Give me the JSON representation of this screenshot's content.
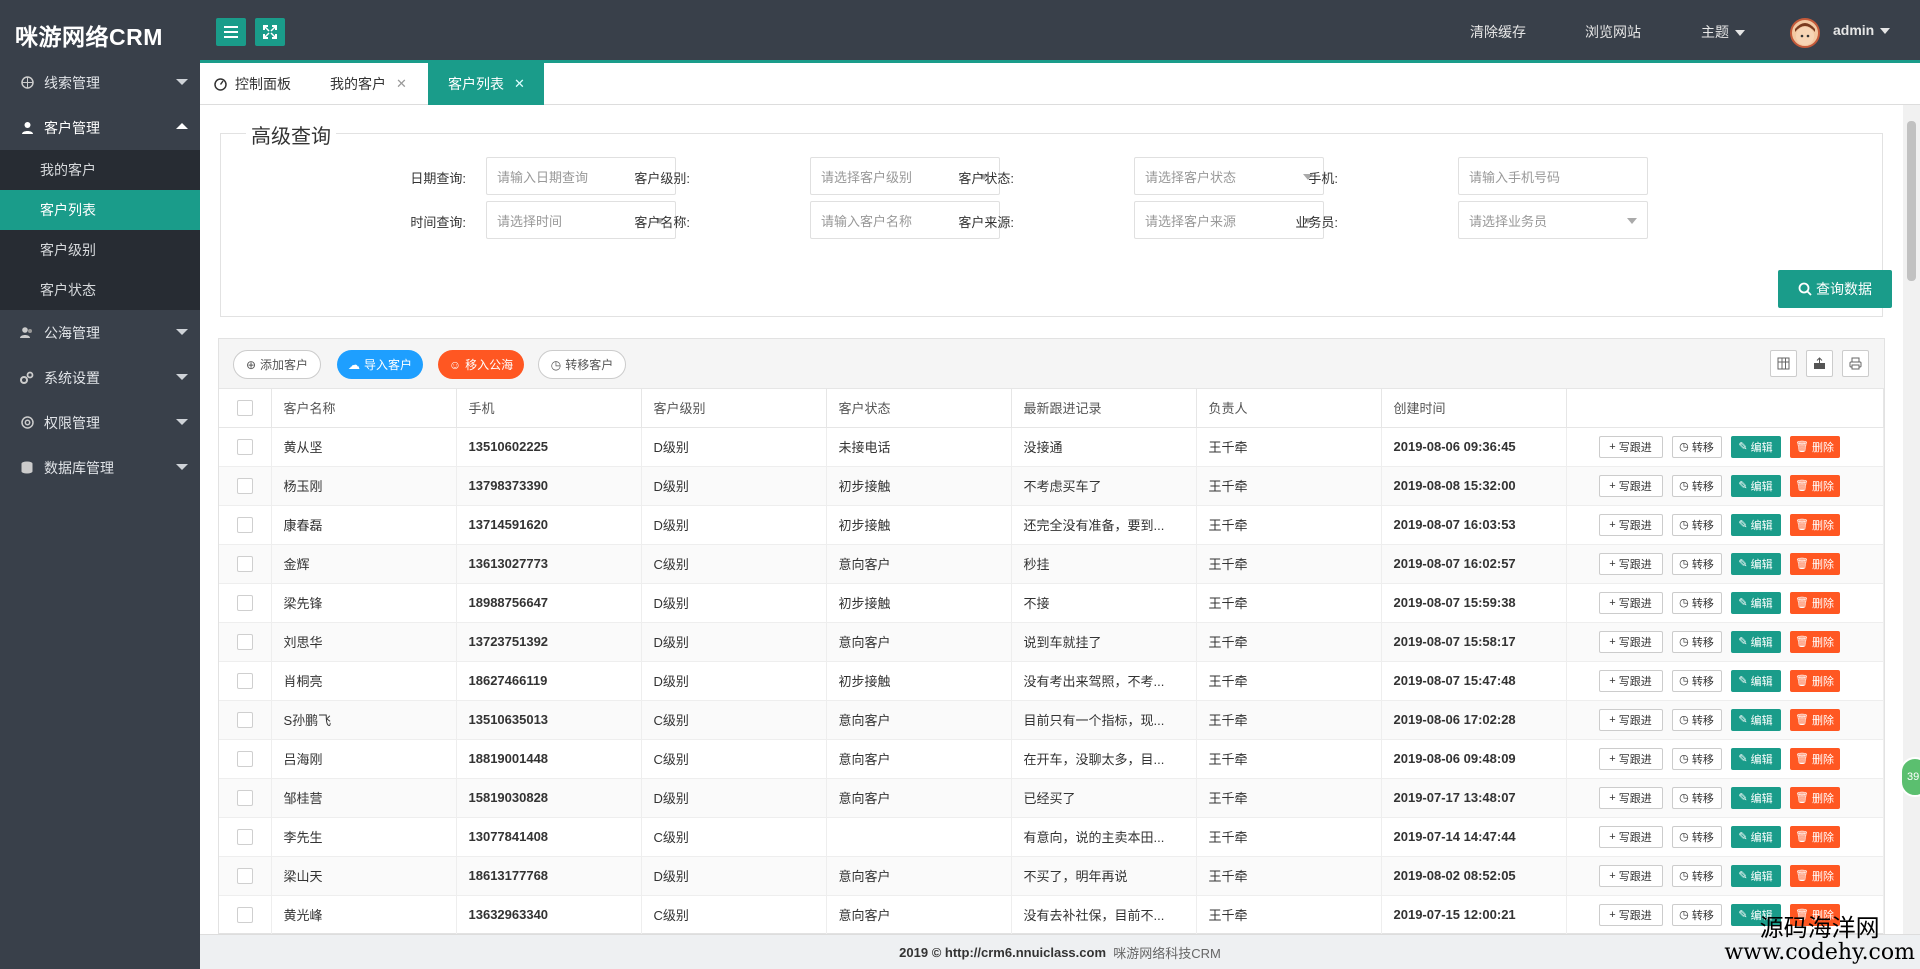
{
  "app": {
    "logo": "咪游网络CRM"
  },
  "topnav": {
    "clear_cache": "清除缓存",
    "browse_site": "浏览网站",
    "theme": "主题",
    "user": "admin"
  },
  "sidebar": {
    "items": [
      {
        "label": "线索管理",
        "icon": "globe-icon"
      },
      {
        "label": "客户管理",
        "icon": "user-icon"
      },
      {
        "label": "公海管理",
        "icon": "users-icon"
      },
      {
        "label": "系统设置",
        "icon": "gears-icon"
      },
      {
        "label": "权限管理",
        "icon": "lifebuoy-icon"
      },
      {
        "label": "数据库管理",
        "icon": "database-icon"
      }
    ],
    "sub": [
      "我的客户",
      "客户列表",
      "客户级别",
      "客户状态"
    ]
  },
  "tabs": [
    {
      "label": "控制面板"
    },
    {
      "label": "我的客户"
    },
    {
      "label": "客户列表"
    }
  ],
  "search": {
    "legend": "高级查询",
    "date_label": "日期查询:",
    "date_ph": "请输入日期查询",
    "level_label": "客户级别:",
    "level_ph": "请选择客户级别",
    "status_label": "客户状态:",
    "status_ph": "请选择客户状态",
    "phone_label": "手机:",
    "phone_ph": "请输入手机号码",
    "time_label": "时间查询:",
    "time_ph": "请选择时间",
    "name_label": "客户名称:",
    "name_ph": "请输入客户名称",
    "source_label": "客户来源:",
    "source_ph": "请选择客户来源",
    "sales_label": "业务员:",
    "sales_ph": "请选择业务员",
    "query_btn": "查询数据"
  },
  "toolbar": {
    "add": "添加客户",
    "import": "导入客户",
    "to_pool": "移入公海",
    "transfer": "转移客户"
  },
  "table": {
    "headers": [
      "客户名称",
      "手机",
      "客户级别",
      "客户状态",
      "最新跟进记录",
      "负责人",
      "创建时间"
    ],
    "actions": {
      "follow": "写跟进",
      "transfer": "转移",
      "edit": "编辑",
      "delete": "删除"
    },
    "rows": [
      {
        "name": "黄从坚",
        "phone": "13510602225",
        "level": "D级别",
        "status": "未接电话",
        "record": "没接通",
        "owner": "王千牵",
        "created": "2019-08-06 09:36:45"
      },
      {
        "name": "杨玉刚",
        "phone": "13798373390",
        "level": "D级别",
        "status": "初步接触",
        "record": "不考虑买车了",
        "owner": "王千牵",
        "created": "2019-08-08 15:32:00"
      },
      {
        "name": "康春磊",
        "phone": "13714591620",
        "level": "D级别",
        "status": "初步接触",
        "record": "还完全没有准备，要到...",
        "owner": "王千牵",
        "created": "2019-08-07 16:03:53"
      },
      {
        "name": "金辉",
        "phone": "13613027773",
        "level": "C级别",
        "status": "意向客户",
        "record": "秒挂",
        "owner": "王千牵",
        "created": "2019-08-07 16:02:57"
      },
      {
        "name": "梁先锋",
        "phone": "18988756647",
        "level": "D级别",
        "status": "初步接触",
        "record": "不接",
        "owner": "王千牵",
        "created": "2019-08-07 15:59:38"
      },
      {
        "name": "刘思华",
        "phone": "13723751392",
        "level": "D级别",
        "status": "意向客户",
        "record": "说到车就挂了",
        "owner": "王千牵",
        "created": "2019-08-07 15:58:17"
      },
      {
        "name": "肖桐亮",
        "phone": "18627466119",
        "level": "D级别",
        "status": "初步接触",
        "record": "没有考出来驾照，不考...",
        "owner": "王千牵",
        "created": "2019-08-07 15:47:48"
      },
      {
        "name": "S孙鹏飞",
        "phone": "13510635013",
        "level": "C级别",
        "status": "意向客户",
        "record": "目前只有一个指标，现...",
        "owner": "王千牵",
        "created": "2019-08-06 17:02:28"
      },
      {
        "name": "吕海刚",
        "phone": "18819001448",
        "level": "C级别",
        "status": "意向客户",
        "record": "在开车，没聊太多，目...",
        "owner": "王千牵",
        "created": "2019-08-06 09:48:09"
      },
      {
        "name": "邹桂营",
        "phone": "15819030828",
        "level": "D级别",
        "status": "意向客户",
        "record": "已经买了",
        "owner": "王千牵",
        "created": "2019-07-17 13:48:07"
      },
      {
        "name": "李先生",
        "phone": "13077841408",
        "level": "C级别",
        "status": "",
        "record": "有意向，说的主卖本田...",
        "owner": "王千牵",
        "created": "2019-07-14 14:47:44"
      },
      {
        "name": "梁山天",
        "phone": "18613177768",
        "level": "D级别",
        "status": "意向客户",
        "record": "不买了，明年再说",
        "owner": "王千牵",
        "created": "2019-08-02 08:52:05"
      },
      {
        "name": "黄光峰",
        "phone": "13632963340",
        "level": "C级别",
        "status": "意向客户",
        "record": "没有去补社保，目前不...",
        "owner": "王千牵",
        "created": "2019-07-15 12:00:21"
      }
    ]
  },
  "footer": {
    "year": "2019 ©",
    "url": "http://crm6.nnuiclass.com",
    "company": "咪游网络科技CRM"
  },
  "watermark": {
    "line1": "源码海洋网",
    "line2": "www.codehy.com"
  },
  "float_badge": "39",
  "colors": {
    "accent": "#1a9c8a",
    "danger": "#ff5722",
    "primary_blue": "#1e9fff",
    "dark": "#39404a"
  }
}
